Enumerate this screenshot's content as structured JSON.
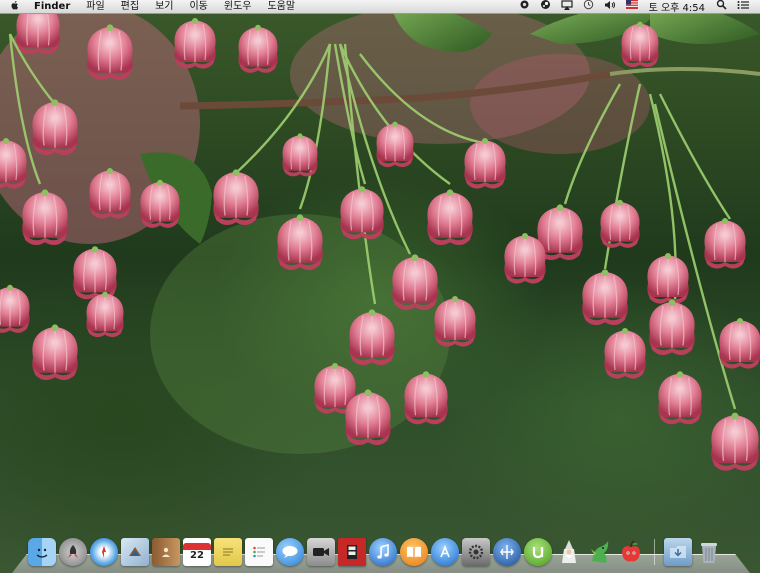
{
  "menubar": {
    "apple": "",
    "app_name": "Finder",
    "menus": [
      "파일",
      "편집",
      "보기",
      "이동",
      "윈도우",
      "도움말"
    ],
    "status_icons": [
      "gear-icon",
      "steam-icon",
      "airplay-icon",
      "time-machine-icon",
      "volume-icon",
      "us-flag-icon"
    ],
    "clock": "토 오후 4:54",
    "spotlight": "spotlight-icon",
    "notifications": "notification-center-icon"
  },
  "dock": {
    "calendar_day": "22",
    "apps": [
      {
        "name": "finder",
        "icon": "finder-icon"
      },
      {
        "name": "launchpad",
        "icon": "rocket-icon"
      },
      {
        "name": "safari",
        "icon": "compass-icon"
      },
      {
        "name": "mail",
        "icon": "stamp-icon"
      },
      {
        "name": "contacts",
        "icon": "address-book-icon"
      },
      {
        "name": "calendar",
        "icon": "calendar-icon"
      },
      {
        "name": "notes",
        "icon": "notepad-icon"
      },
      {
        "name": "reminders",
        "icon": "checklist-icon"
      },
      {
        "name": "messages",
        "icon": "speech-bubble-icon"
      },
      {
        "name": "facetime",
        "icon": "video-camera-icon"
      },
      {
        "name": "photo-booth",
        "icon": "photo-strip-icon"
      },
      {
        "name": "itunes",
        "icon": "music-note-icon"
      },
      {
        "name": "ibooks",
        "icon": "book-icon"
      },
      {
        "name": "app-store",
        "icon": "app-store-icon"
      },
      {
        "name": "system-preferences",
        "icon": "gears-icon"
      },
      {
        "name": "boot-camp",
        "icon": "disk-split-icon"
      },
      {
        "name": "utorrent",
        "icon": "utorrent-icon"
      },
      {
        "name": "wizard-app",
        "icon": "wizard-icon"
      },
      {
        "name": "dragon-app",
        "icon": "dragon-icon"
      },
      {
        "name": "apple-game",
        "icon": "red-apple-icon"
      }
    ],
    "downloads": "downloads-folder-icon",
    "trash": "trash-icon"
  },
  "colors": {
    "petal": "#d8607a",
    "petal_light": "#f6c6d0",
    "stem": "#9fd070",
    "leaf": "#3f7a2c",
    "branch": "#6b4a3a"
  }
}
